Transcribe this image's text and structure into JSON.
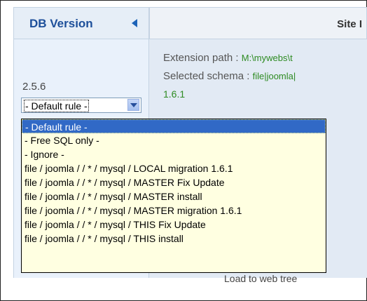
{
  "header": {
    "col1_title": "DB Version",
    "col2_title": "Site I"
  },
  "row": {
    "version": "2.5.6",
    "select_value": "- Default rule -",
    "extension_label": "Extension path : ",
    "extension_value": "M:\\mywebs\\t",
    "schema_label": "Selected schema : ",
    "schema_value": "file|joomla|",
    "schema_version": "1.6.1",
    "below_text": "Load to web tree"
  },
  "dropdown": {
    "options": [
      "- Default rule -",
      "- Free SQL only -",
      "- Ignore -",
      "file / joomla / / * / mysql / LOCAL migration 1.6.1",
      "file / joomla / / * / mysql / MASTER Fix Update",
      "file / joomla / / * / mysql / MASTER install",
      "file / joomla / / * / mysql / MASTER migration 1.6.1",
      "file / joomla / / * / mysql / THIS Fix Update",
      "file / joomla / / * / mysql / THIS install"
    ],
    "selected_index": 0
  },
  "colors": {
    "header_text": "#1d4f9a",
    "selected_bg": "#3169c6",
    "dropdown_bg": "#ffffe1",
    "green_value": "#2e8b22"
  }
}
